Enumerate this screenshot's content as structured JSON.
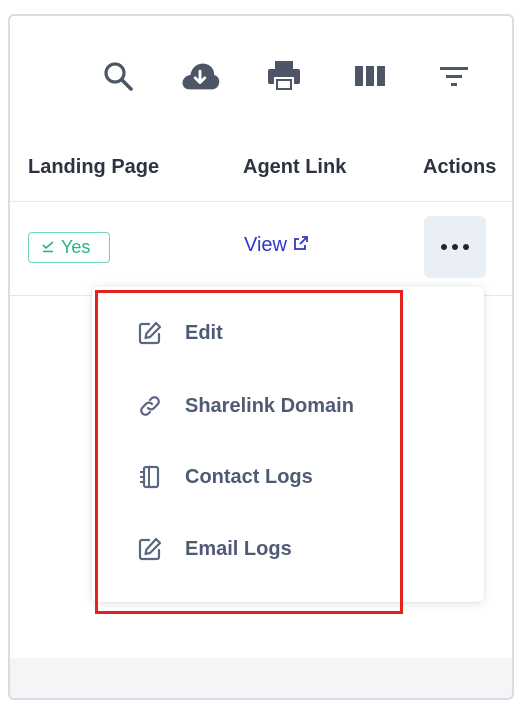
{
  "toolbar": {
    "icons": [
      "search-icon",
      "cloud-download-icon",
      "print-icon",
      "columns-icon",
      "filter-icon"
    ]
  },
  "table": {
    "columns": [
      "Landing Page",
      "Agent Link",
      "Actions"
    ],
    "row": {
      "landing_page_badge": "Yes",
      "agent_link_text": "View"
    }
  },
  "actions_menu": {
    "items": [
      {
        "label": "Edit",
        "icon": "edit-icon"
      },
      {
        "label": "Sharelink Domain",
        "icon": "link-icon"
      },
      {
        "label": "Contact Logs",
        "icon": "notebook-icon"
      },
      {
        "label": "Email Logs",
        "icon": "edit-icon"
      }
    ]
  },
  "colors": {
    "highlight_border": "#e3211f",
    "badge_green": "#27b384",
    "link_blue": "#2f36c8",
    "menu_text": "#4f5b74"
  }
}
